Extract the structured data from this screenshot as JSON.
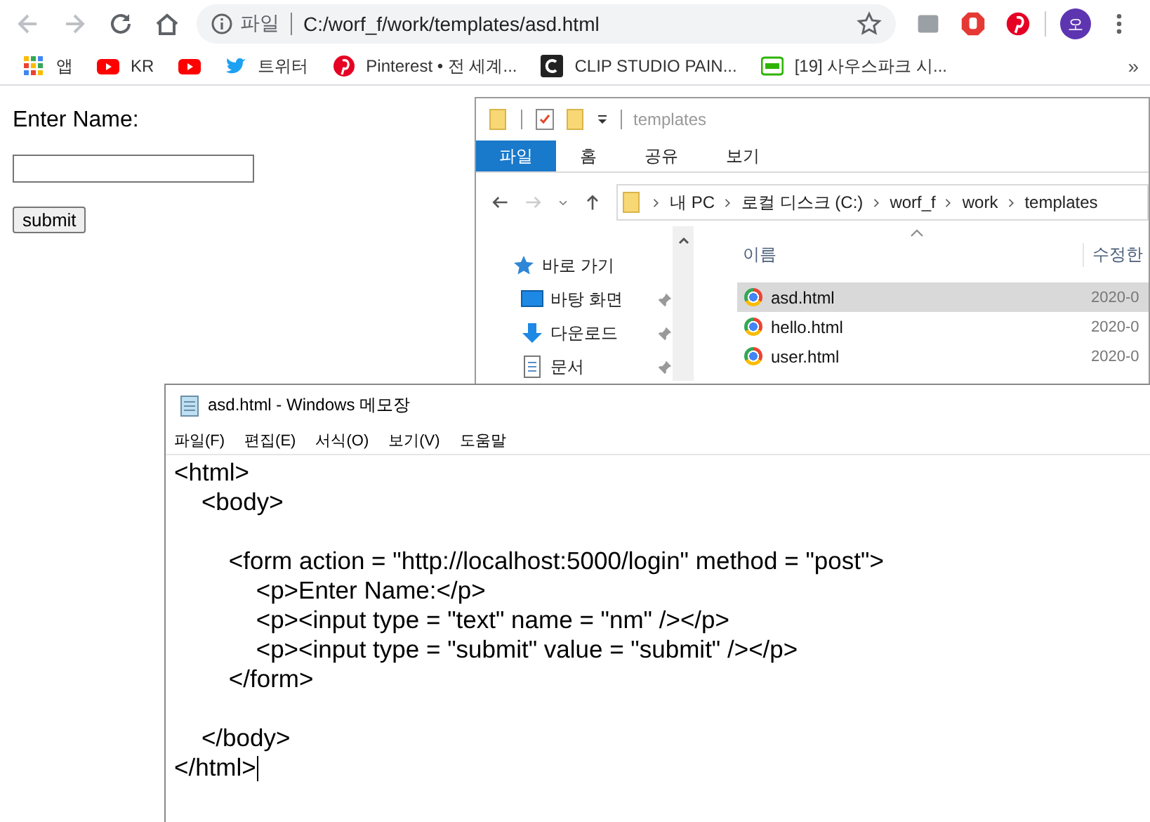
{
  "browser": {
    "back_disabled": true,
    "forward_disabled": true,
    "scheme_label": "파일",
    "url": "C:/worf_f/work/templates/asd.html",
    "avatar": "오",
    "bookmarks": [
      {
        "kind": "apps",
        "label": "앱"
      },
      {
        "kind": "youtube",
        "label": "KR"
      },
      {
        "kind": "youtube"
      },
      {
        "kind": "twitter",
        "label": "트위터"
      },
      {
        "kind": "pinterest",
        "label": "Pinterest • 전 세계..."
      },
      {
        "kind": "clip",
        "label": "CLIP STUDIO PAIN..."
      },
      {
        "kind": "blog",
        "label": "[19] 사우스파크 시..."
      }
    ],
    "overflow": "»"
  },
  "page": {
    "label": "Enter Name:",
    "button": "submit"
  },
  "explorer": {
    "title": "templates",
    "ribbon_tabs": [
      {
        "label": "파일",
        "selected": true
      },
      {
        "label": "홈",
        "selected": false
      },
      {
        "label": "공유",
        "selected": false
      },
      {
        "label": "보기",
        "selected": false
      }
    ],
    "path": [
      "내 PC",
      "로컬 디스크 (C:)",
      "worf_f",
      "work",
      "templates"
    ],
    "nav_items": [
      {
        "kind": "star",
        "label": "바로 가기",
        "pinned": false
      },
      {
        "kind": "desktop",
        "label": "바탕 화면",
        "pinned": true
      },
      {
        "kind": "download",
        "label": "다운로드",
        "pinned": true
      },
      {
        "kind": "document",
        "label": "문서",
        "pinned": true
      }
    ],
    "columns": [
      "이름",
      "수정한"
    ],
    "files": [
      {
        "name": "asd.html",
        "modified": "2020-0",
        "selected": true
      },
      {
        "name": "hello.html",
        "modified": "2020-0",
        "selected": false
      },
      {
        "name": "user.html",
        "modified": "2020-0",
        "selected": false
      }
    ]
  },
  "notepad": {
    "title": "asd.html - Windows 메모장",
    "menu": [
      "파일(F)",
      "편집(E)",
      "서식(O)",
      "보기(V)",
      "도움말"
    ],
    "text": "<html>\n    <body>\n\n        <form action = \"http://localhost:5000/login\" method = \"post\">\n            <p>Enter Name:</p>\n            <p><input type = \"text\" name = \"nm\" /></p>\n            <p><input type = \"submit\" value = \"submit\" /></p>\n        </form>\n\n    </body>\n</html>"
  }
}
